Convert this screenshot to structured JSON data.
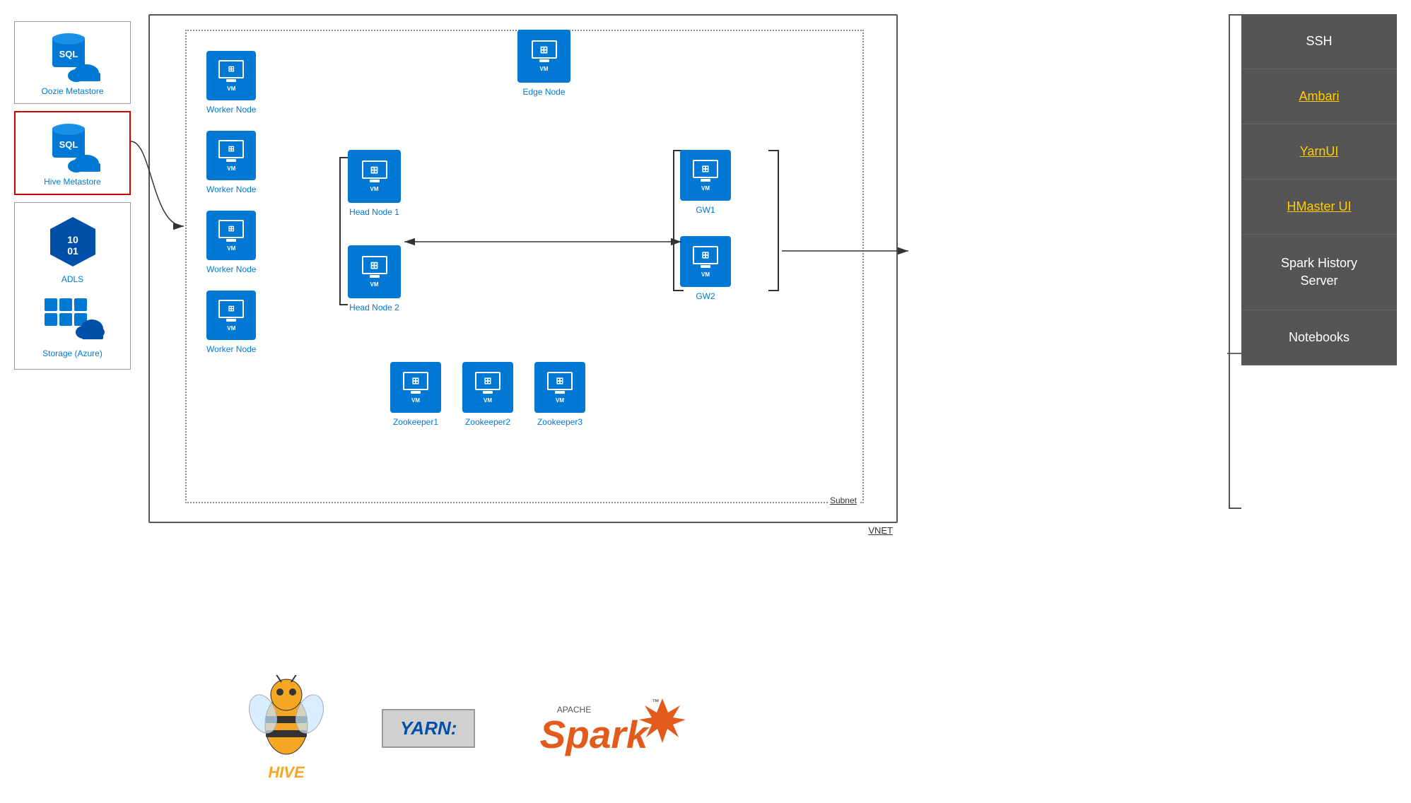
{
  "left_panel": {
    "oozie": {
      "label": "Oozie Metastore",
      "type": "sql"
    },
    "hive": {
      "label": "Hive Metastore",
      "type": "sql",
      "selected": true
    },
    "adls": {
      "label": "ADLS",
      "type": "adls"
    },
    "storage": {
      "label": "Storage (Azure)",
      "type": "storage"
    }
  },
  "diagram": {
    "vnet_label": "VNET",
    "subnet_label": "Subnet",
    "worker_nodes": [
      {
        "label": "Worker Node"
      },
      {
        "label": "Worker Node"
      },
      {
        "label": "Worker Node"
      },
      {
        "label": "Worker Node"
      }
    ],
    "head_nodes": [
      {
        "label": "Head Node 1"
      },
      {
        "label": "Head Node 2"
      }
    ],
    "edge_node": {
      "label": "Edge Node"
    },
    "gw_nodes": [
      {
        "label": "GW1"
      },
      {
        "label": "GW2"
      }
    ],
    "zookeeper_nodes": [
      {
        "label": "Zookeeper1"
      },
      {
        "label": "Zookeeper2"
      },
      {
        "label": "Zookeeper3"
      }
    ],
    "vm_text": "VM"
  },
  "right_panel": {
    "buttons": [
      {
        "label": "SSH",
        "style": "normal"
      },
      {
        "label": "Ambari",
        "style": "link"
      },
      {
        "label": "YarnUI",
        "style": "link"
      },
      {
        "label": "HMaster UI",
        "style": "link"
      },
      {
        "label": "Spark History\nServer",
        "style": "normal"
      },
      {
        "label": "Notebooks",
        "style": "normal"
      }
    ]
  },
  "bottom_logos": {
    "hive_text": "HIVE",
    "yarn_text": "YARN:",
    "spark_apache": "APACHE",
    "spark_text": "Spark"
  }
}
